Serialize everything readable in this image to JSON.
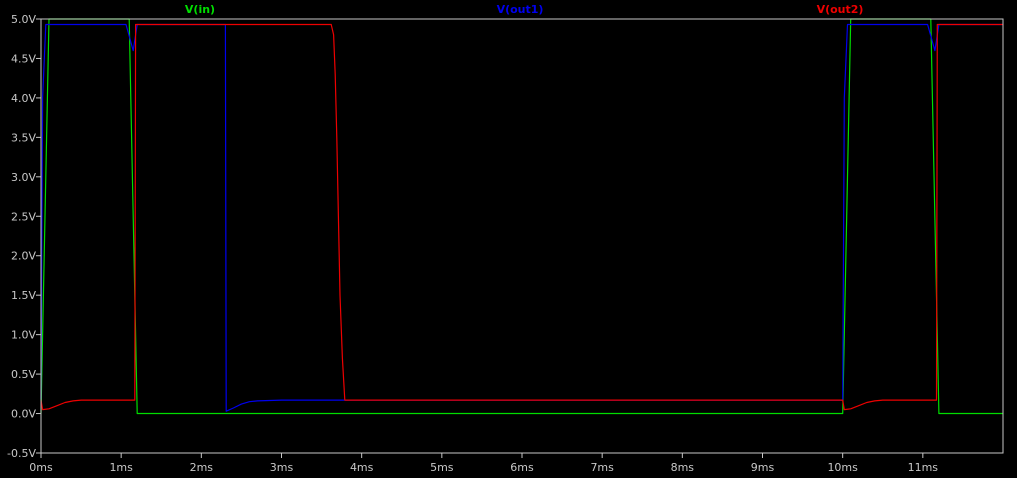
{
  "chart_data": {
    "type": "line",
    "title": "",
    "xlabel": "",
    "ylabel": "",
    "xlim": [
      0,
      12
    ],
    "ylim": [
      -0.5,
      5.0
    ],
    "x_ticks": [
      0,
      1,
      2,
      3,
      4,
      5,
      6,
      7,
      8,
      9,
      10,
      11
    ],
    "x_tick_labels": [
      "0ms",
      "1ms",
      "2ms",
      "3ms",
      "4ms",
      "5ms",
      "6ms",
      "7ms",
      "8ms",
      "9ms",
      "10ms",
      "11ms"
    ],
    "y_ticks": [
      -0.5,
      0.0,
      0.5,
      1.0,
      1.5,
      2.0,
      2.5,
      3.0,
      3.5,
      4.0,
      4.5,
      5.0
    ],
    "y_tick_labels": [
      "-0.5V",
      "0.0V",
      "0.5V",
      "1.0V",
      "1.5V",
      "2.0V",
      "2.5V",
      "3.0V",
      "3.5V",
      "4.0V",
      "4.5V",
      "5.0V"
    ],
    "grid": false,
    "background": "#000000",
    "frame_color": "#c8c8c8",
    "legend_placement": "top",
    "series": [
      {
        "name": "V(in)",
        "color": "#00dd00",
        "points": [
          [
            0.0,
            0.0
          ],
          [
            0.1,
            5.0
          ],
          [
            1.1,
            5.0
          ],
          [
            1.2,
            0.0
          ],
          [
            10.0,
            0.0
          ],
          [
            10.1,
            5.0
          ],
          [
            11.1,
            5.0
          ],
          [
            11.2,
            0.0
          ],
          [
            12.0,
            0.0
          ]
        ]
      },
      {
        "name": "V(out1)",
        "color": "#0000ee",
        "points": [
          [
            0.0,
            0.18
          ],
          [
            0.02,
            4.0
          ],
          [
            0.06,
            4.93
          ],
          [
            1.06,
            4.93
          ],
          [
            1.15,
            4.6
          ],
          [
            1.2,
            4.93
          ],
          [
            2.3,
            4.93
          ],
          [
            2.31,
            0.03
          ],
          [
            2.4,
            0.07
          ],
          [
            2.5,
            0.12
          ],
          [
            2.6,
            0.15
          ],
          [
            2.7,
            0.16
          ],
          [
            3.0,
            0.17
          ],
          [
            10.0,
            0.17
          ],
          [
            10.02,
            4.0
          ],
          [
            10.06,
            4.93
          ],
          [
            11.06,
            4.93
          ],
          [
            11.15,
            4.6
          ],
          [
            11.2,
            4.93
          ],
          [
            12.0,
            4.93
          ]
        ]
      },
      {
        "name": "V(out2)",
        "color": "#ee0000",
        "points": [
          [
            0.0,
            0.17
          ],
          [
            0.02,
            0.05
          ],
          [
            0.1,
            0.06
          ],
          [
            0.2,
            0.1
          ],
          [
            0.3,
            0.14
          ],
          [
            0.4,
            0.16
          ],
          [
            0.5,
            0.17
          ],
          [
            1.17,
            0.17
          ],
          [
            1.18,
            4.93
          ],
          [
            3.62,
            4.93
          ],
          [
            3.65,
            4.8
          ],
          [
            3.67,
            4.3
          ],
          [
            3.69,
            3.5
          ],
          [
            3.71,
            2.5
          ],
          [
            3.73,
            1.5
          ],
          [
            3.76,
            0.7
          ],
          [
            3.79,
            0.17
          ],
          [
            10.0,
            0.17
          ],
          [
            10.02,
            0.05
          ],
          [
            10.1,
            0.06
          ],
          [
            10.2,
            0.1
          ],
          [
            10.3,
            0.14
          ],
          [
            10.4,
            0.16
          ],
          [
            10.5,
            0.17
          ],
          [
            11.17,
            0.17
          ],
          [
            11.18,
            4.93
          ],
          [
            12.0,
            4.93
          ]
        ]
      }
    ]
  }
}
